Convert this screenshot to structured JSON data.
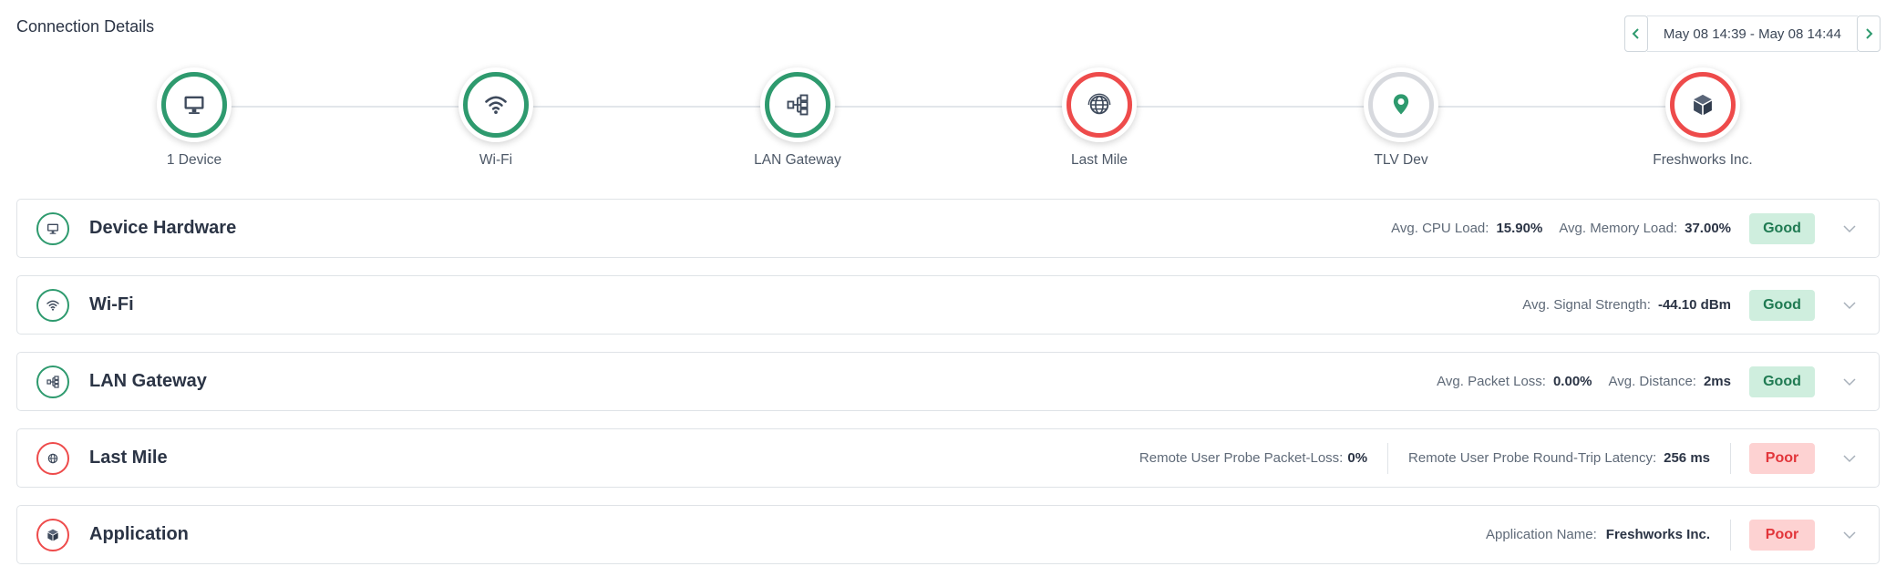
{
  "header": {
    "title": "Connection Details",
    "date_range": "May 08 14:39 - May 08 14:44"
  },
  "flow": {
    "nodes": [
      {
        "label": "1 Device",
        "icon": "monitor-icon",
        "status": "good"
      },
      {
        "label": "Wi-Fi",
        "icon": "wifi-icon",
        "status": "good"
      },
      {
        "label": "LAN Gateway",
        "icon": "network-icon",
        "status": "good"
      },
      {
        "label": "Last Mile",
        "icon": "globe-icon",
        "status": "poor"
      },
      {
        "label": "TLV Dev",
        "icon": "location-pin-icon",
        "status": "neutral"
      },
      {
        "label": "Freshworks Inc.",
        "icon": "cube-icon",
        "status": "poor"
      }
    ]
  },
  "panels": [
    {
      "title": "Device Hardware",
      "icon": "monitor-icon",
      "status": "Good",
      "metrics": [
        {
          "label": "Avg. CPU Load:",
          "value": "15.90%"
        },
        {
          "label": "Avg. Memory Load:",
          "value": "37.00%"
        }
      ]
    },
    {
      "title": "Wi-Fi",
      "icon": "wifi-icon",
      "status": "Good",
      "metrics": [
        {
          "label": "Avg. Signal Strength:",
          "value": "-44.10 dBm"
        }
      ]
    },
    {
      "title": "LAN Gateway",
      "icon": "network-icon",
      "status": "Good",
      "metrics": [
        {
          "label": "Avg. Packet Loss:",
          "value": "0.00%"
        },
        {
          "label": "Avg. Distance:",
          "value": "2ms"
        }
      ]
    },
    {
      "title": "Last Mile",
      "icon": "globe-icon",
      "status": "Poor",
      "metrics": [
        {
          "label": "Remote User Probe Packet-Loss:",
          "value": "0%"
        },
        {
          "label": "Remote User Probe Round-Trip Latency:",
          "value": "256 ms"
        }
      ]
    },
    {
      "title": "Application",
      "icon": "cube-icon",
      "status": "Poor",
      "metrics": [
        {
          "label": "Application Name:",
          "value": "Freshworks Inc."
        }
      ]
    }
  ],
  "colors": {
    "good": "#2e9a6e",
    "poor": "#ee4b4b",
    "neutral": "#d7d9de",
    "good_badge_bg": "#cfeede",
    "poor_badge_bg": "#fdd2d2"
  }
}
